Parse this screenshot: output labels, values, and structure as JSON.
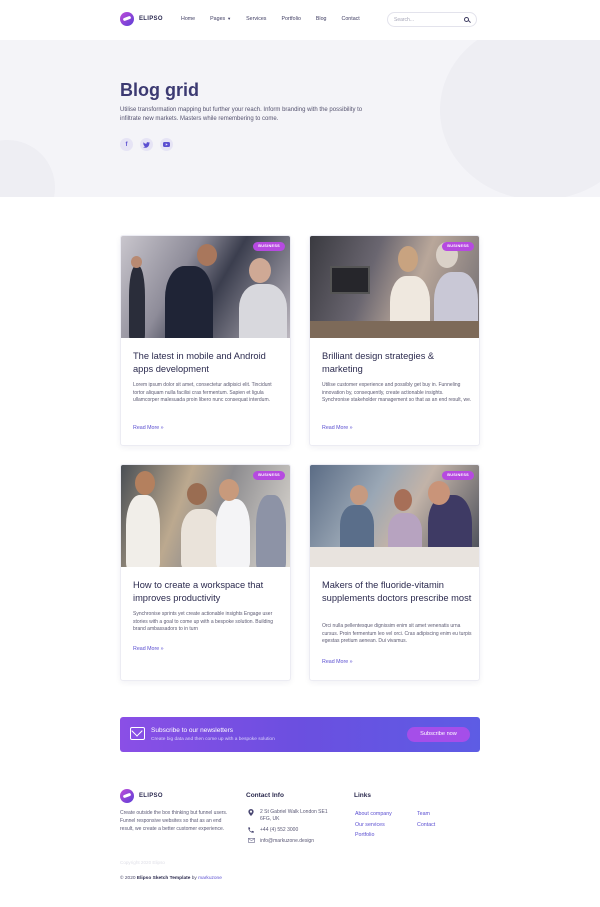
{
  "brand": {
    "name": "ELIPSO"
  },
  "nav": {
    "items": [
      "Home",
      "Pages",
      "Services",
      "Portfolio",
      "Blog",
      "Contact"
    ]
  },
  "search": {
    "placeholder": "Search..."
  },
  "hero": {
    "title": "Blog grid",
    "text": "Utilise transformation mapping but further your reach. Inform branding with the possibility to infiltrate new markets. Masters while remembering to come.",
    "socials": [
      "facebook-icon",
      "twitter-icon",
      "youtube-icon"
    ]
  },
  "posts": [
    {
      "badge": "BUSINESS",
      "title": "The latest in mobile and Android apps development",
      "excerpt": "Lorem ipsum dolor sit amet, consectetur adipisici elit. Tincidunt tortor aliquam nulla facilisi cras fermentum. Sapien et ligula ullamcorper malesuada proin libero nunc consequat interdum.",
      "more": "Read More »"
    },
    {
      "badge": "BUSINESS",
      "title": "Brilliant design strategies & marketing",
      "excerpt": "Utilise customer experience and possibly get buy in. Funneling innovation by, consequently, create actionable insights. Synchronise stakeholder management so that as an end result, we.",
      "more": "Read More »"
    },
    {
      "badge": "BUSINESS",
      "title": "How to create a workspace that improves productivity",
      "excerpt": "Synchronise sprints yet create actionable insights Engage user stories with a goal to come up with a bespoke solution. Building brand ambassadors to in turn",
      "more": "Read More »"
    },
    {
      "badge": "BUSINESS",
      "title": "Makers of the fluoride-vitamin supplements doctors prescribe most",
      "excerpt": "Orci nulla pellentesque dignissim enim sit amet venenatis urna cursus. Proin fermentum leo vel orci. Cras adipiscing enim eu turpis egestas pretium aenean. Dui vivamus.",
      "more": "Read More »"
    }
  ],
  "newsletter": {
    "title": "Subscribe to our newsletters",
    "subtitle": "Create big data and then come up with a bespoke solution",
    "button": "Subscribe now"
  },
  "footer": {
    "about": "Create outside the box thinking but funnel users. Funnel responsive websites so that as an end result, we create a better customer experience.",
    "contact_heading": "Contact Info",
    "address_line1": "2 St Gabriel Walk London SE1",
    "address_line2": "6FG, UK",
    "phone": "+44 (4) 552 3000",
    "email": "info@markuzone.design",
    "links_heading": "Links",
    "links_col1": [
      "About company",
      "Our services",
      "Portfolio"
    ],
    "links_col2": [
      "Team",
      "Contact"
    ],
    "faint_text": "Copyright 2020 Elipso",
    "copyright_year": "© 2020",
    "copyright_name": "Elipso Sketch Template",
    "copyright_by": "by",
    "copyright_author": "markuzone"
  },
  "colors": {
    "accent": "#5b4fd1",
    "badge": "#b64ae0",
    "title": "#3c3a72"
  }
}
